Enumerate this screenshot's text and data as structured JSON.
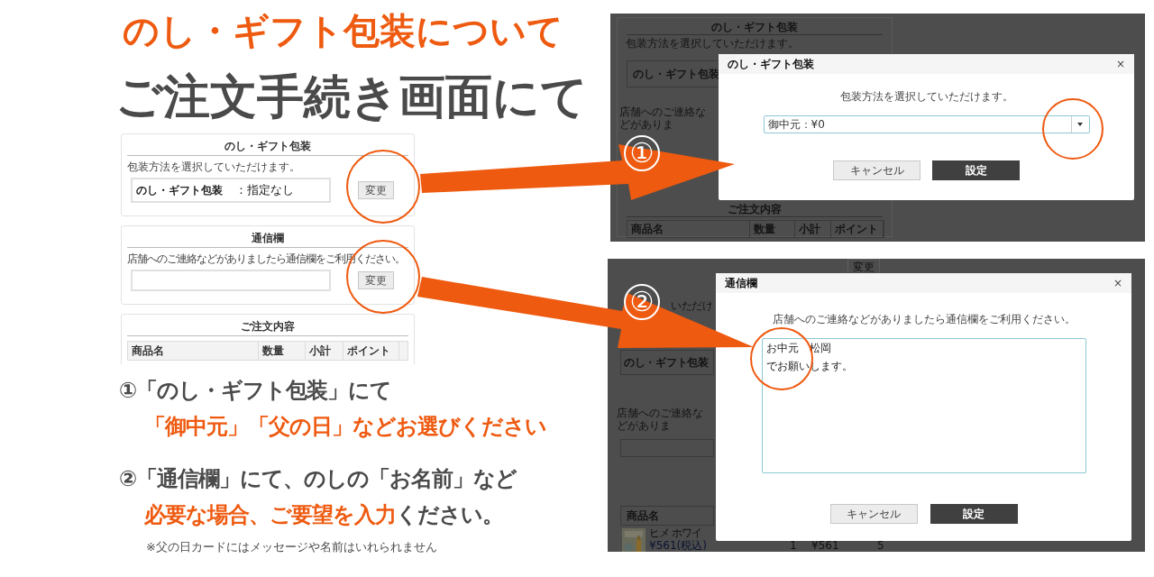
{
  "title": "のし・ギフト包装について",
  "subtitle": "ご注文手続き画面にて",
  "order_page": {
    "gift_section": {
      "heading": "のし・ギフト包装",
      "description": "包装方法を選択していただけます。",
      "field_label": "のし・ギフト包装",
      "field_value": "：指定なし",
      "button": "変更"
    },
    "message_section": {
      "heading": "通信欄",
      "description": "店舗へのご連絡などがありましたら通信欄をご利用ください。",
      "button": "変更"
    },
    "order_section": {
      "heading": "ご注文内容",
      "columns": [
        "商品名",
        "数量",
        "小計",
        "ポイント"
      ]
    }
  },
  "screen_1": {
    "marker": "①",
    "backdrop": {
      "heading": "のし・ギフト包装",
      "description": "包装方法を選択していただけます。",
      "field_label": "のし・ギフト包装",
      "message_description": "店舗へのご連絡などがありま",
      "order_heading": "ご注文内容",
      "columns": [
        "商品名",
        "数量",
        "小計",
        "ポイント"
      ]
    },
    "dialog": {
      "title": "のし・ギフト包装",
      "close": "×",
      "description": "包装方法を選択していただけます。",
      "select_value": "御中元：¥0",
      "cancel": "キャンセル",
      "confirm": "設定"
    }
  },
  "screen_2": {
    "marker": "②",
    "backdrop": {
      "button": "変更",
      "partial_text": "いただけ",
      "field_label": "のし・ギフト包装",
      "message_description": "店舗へのご連絡などがありま",
      "column": "商品名",
      "product_name": "ヒメ ホワイ",
      "product_price": "¥561(税込)",
      "quantity": "1",
      "subtotal": "¥561",
      "points": "5"
    },
    "dialog": {
      "title": "通信欄",
      "close": "×",
      "description": "店舗へのご連絡などがありましたら通信欄をご利用ください。",
      "message_lines": [
        "お中元　松岡",
        "でお願いします。"
      ],
      "cancel": "キャンセル",
      "confirm": "設定"
    }
  },
  "instructions": [
    {
      "segments": [
        {
          "text": "①「のし・ギフト包装」にて",
          "emphasis": false
        }
      ]
    },
    {
      "segments": [
        {
          "text": "「御中元」「父の日」などお選びください",
          "emphasis": true
        }
      ]
    },
    {
      "segments": [
        {
          "text": "②「通信欄」にて、のしの「お名前」など",
          "emphasis": false
        }
      ]
    },
    {
      "segments": [
        {
          "text": "必要な場合、ご要望を入力",
          "emphasis": true
        },
        {
          "text": "ください。",
          "emphasis": false
        }
      ]
    }
  ],
  "note": "※父の日カードにはメッセージや名前はいれられません"
}
